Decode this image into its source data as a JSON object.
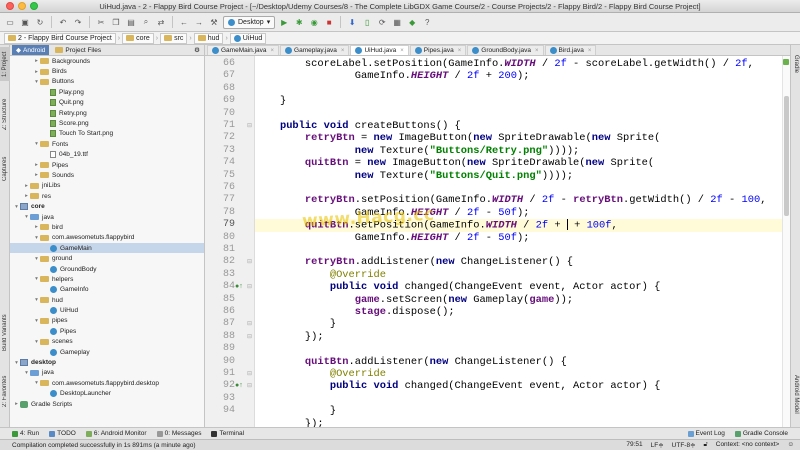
{
  "window": {
    "title": "UiHud.java - 2 - Flappy Bird Course Project - [~/Desktop/Udemy Courses/8 - The Complete LibGDX Game Course/2 - Course Projects/2 - Flappy Bird/2 - Flappy Bird Course Project]"
  },
  "toolbar": {
    "run_config": "Desktop"
  },
  "breadcrumbs": [
    "2 - Flappy Bird Course Project",
    "core",
    "src",
    "hud",
    "UiHud"
  ],
  "project_panel": {
    "tabs": [
      {
        "label": "Android",
        "active": true
      },
      {
        "label": "Project Files",
        "active": false
      }
    ],
    "tree": [
      {
        "label": "Backgrounds",
        "depth": 2,
        "icon": "folder",
        "twisty": "▸"
      },
      {
        "label": "Birds",
        "depth": 2,
        "icon": "folder",
        "twisty": "▸"
      },
      {
        "label": "Buttons",
        "depth": 2,
        "icon": "folder",
        "twisty": "▾"
      },
      {
        "label": "Play.png",
        "depth": 3,
        "icon": "png",
        "twisty": ""
      },
      {
        "label": "Quit.png",
        "depth": 3,
        "icon": "png",
        "twisty": ""
      },
      {
        "label": "Retry.png",
        "depth": 3,
        "icon": "png",
        "twisty": ""
      },
      {
        "label": "Score.png",
        "depth": 3,
        "icon": "png",
        "twisty": ""
      },
      {
        "label": "Touch To Start.png",
        "depth": 3,
        "icon": "png",
        "twisty": ""
      },
      {
        "label": "Fonts",
        "depth": 2,
        "icon": "folder",
        "twisty": "▾"
      },
      {
        "label": "04b_19.ttf",
        "depth": 3,
        "icon": "file",
        "twisty": ""
      },
      {
        "label": "Pipes",
        "depth": 2,
        "icon": "folder",
        "twisty": "▸"
      },
      {
        "label": "Sounds",
        "depth": 2,
        "icon": "folder",
        "twisty": "▸"
      },
      {
        "label": "jniLibs",
        "depth": 1,
        "icon": "folder",
        "twisty": "▸"
      },
      {
        "label": "res",
        "depth": 1,
        "icon": "folder",
        "twisty": "▸"
      },
      {
        "label": "core",
        "depth": 0,
        "icon": "module",
        "twisty": "▾",
        "bold": true
      },
      {
        "label": "java",
        "depth": 1,
        "icon": "src",
        "twisty": "▾"
      },
      {
        "label": "bird",
        "depth": 2,
        "icon": "folder",
        "twisty": "▸"
      },
      {
        "label": "com.awesometuts.flappybird",
        "depth": 2,
        "icon": "folder",
        "twisty": "▾"
      },
      {
        "label": "GameMain",
        "depth": 3,
        "icon": "class",
        "twisty": "",
        "selected": true
      },
      {
        "label": "ground",
        "depth": 2,
        "icon": "folder",
        "twisty": "▾"
      },
      {
        "label": "GroundBody",
        "depth": 3,
        "icon": "class",
        "twisty": ""
      },
      {
        "label": "helpers",
        "depth": 2,
        "icon": "folder",
        "twisty": "▾"
      },
      {
        "label": "GameInfo",
        "depth": 3,
        "icon": "class",
        "twisty": ""
      },
      {
        "label": "hud",
        "depth": 2,
        "icon": "folder",
        "twisty": "▾"
      },
      {
        "label": "UiHud",
        "depth": 3,
        "icon": "class",
        "twisty": ""
      },
      {
        "label": "pipes",
        "depth": 2,
        "icon": "folder",
        "twisty": "▾"
      },
      {
        "label": "Pipes",
        "depth": 3,
        "icon": "class",
        "twisty": ""
      },
      {
        "label": "scenes",
        "depth": 2,
        "icon": "folder",
        "twisty": "▾"
      },
      {
        "label": "Gameplay",
        "depth": 3,
        "icon": "class",
        "twisty": ""
      },
      {
        "label": "desktop",
        "depth": 0,
        "icon": "module",
        "twisty": "▾",
        "bold": true
      },
      {
        "label": "java",
        "depth": 1,
        "icon": "src",
        "twisty": "▾"
      },
      {
        "label": "com.awesometuts.flappybird.desktop",
        "depth": 2,
        "icon": "folder",
        "twisty": "▾"
      },
      {
        "label": "DesktopLauncher",
        "depth": 3,
        "icon": "class",
        "twisty": ""
      },
      {
        "label": "Gradle Scripts",
        "depth": 0,
        "icon": "gradle",
        "twisty": "▸"
      }
    ]
  },
  "left_strip": [
    "1: Project",
    "Z: Structure",
    "Captures",
    "Build Variants",
    "2: Favorites"
  ],
  "right_strip": [
    "Gradle",
    "Android Model"
  ],
  "editor": {
    "tabs": [
      {
        "label": "GameMain.java",
        "active": false
      },
      {
        "label": "Gameplay.java",
        "active": false
      },
      {
        "label": "UiHud.java",
        "active": true
      },
      {
        "label": "Pipes.java",
        "active": false
      },
      {
        "label": "GroundBody.java",
        "active": false
      },
      {
        "label": "Bird.java",
        "active": false
      }
    ],
    "line_numbers": [
      "66",
      "67",
      "68",
      "69",
      "70",
      "71",
      "72",
      "73",
      "74",
      "75",
      "76",
      "77",
      "78",
      "79",
      "80",
      "81",
      "82",
      "83",
      "84",
      "85",
      "86",
      "87",
      "88",
      "89",
      "90",
      "91",
      "92",
      "93",
      "94"
    ],
    "current_line": "79"
  },
  "watermark": "www.Hacg.cc",
  "bottom_tools": {
    "left": [
      "4: Run",
      "TODO",
      "6: Android Monitor",
      "0: Messages",
      "Terminal"
    ],
    "right": [
      "Event Log",
      "Gradle Console"
    ]
  },
  "status": {
    "message": "Compilation completed successfully in 1s 891ms (a minute ago)",
    "position": "79:51",
    "line_sep": "LF≑",
    "encoding": "UTF-8≑",
    "context": "Context: <no context>"
  }
}
